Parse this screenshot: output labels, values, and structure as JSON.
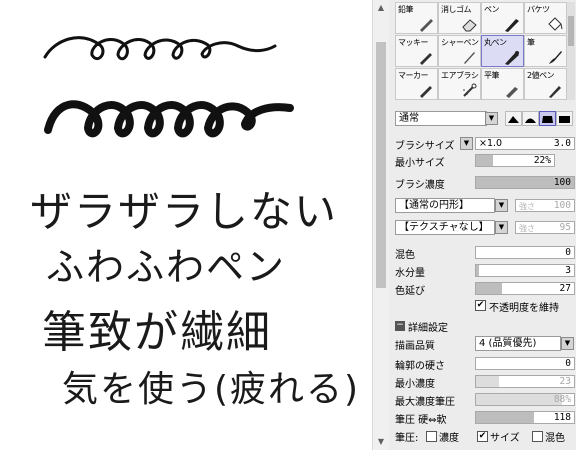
{
  "canvas": {
    "lines": [
      "ザラザラしない",
      "ふわふわペン",
      "筆致が繊細",
      "気を使う(疲れる)"
    ]
  },
  "tools": [
    {
      "label": "鉛筆",
      "icon": "pencil-icon",
      "selected": false
    },
    {
      "label": "消しゴム",
      "icon": "eraser-icon",
      "selected": false
    },
    {
      "label": "ペン",
      "icon": "pen-icon",
      "selected": false
    },
    {
      "label": "バケツ",
      "icon": "bucket-icon",
      "selected": false
    },
    {
      "label": "マッキー",
      "icon": "marker-icon",
      "selected": false
    },
    {
      "label": "シャーペン",
      "icon": "mechanical-pencil-icon",
      "selected": false
    },
    {
      "label": "丸ペン",
      "icon": "round-pen-icon",
      "selected": true
    },
    {
      "label": "筆",
      "icon": "brush-icon",
      "selected": false
    },
    {
      "label": "マーカー",
      "icon": "marker-icon",
      "selected": false
    },
    {
      "label": "エアブラシ",
      "icon": "airbrush-icon",
      "selected": false
    },
    {
      "label": "平筆",
      "icon": "flat-brush-icon",
      "selected": false
    },
    {
      "label": "2値ペン",
      "icon": "binary-pen-icon",
      "selected": false
    }
  ],
  "blend_mode": "通常",
  "brush_size": {
    "label": "ブラシサイズ",
    "multiplier": "×1.0",
    "value": "3.0"
  },
  "min_size": {
    "label": "最小サイズ",
    "value": "22%",
    "fraction": 0.22
  },
  "brush_density": {
    "label": "ブラシ濃度",
    "value": "100",
    "fraction": 1.0
  },
  "shape_select": {
    "value": "【通常の円形】",
    "strength_label": "強さ",
    "strength": "100"
  },
  "texture_select": {
    "value": "【テクスチャなし】",
    "strength_label": "強さ",
    "strength": "95"
  },
  "mix": {
    "label": "混色",
    "value": "0",
    "fraction": 0.0
  },
  "water": {
    "label": "水分量",
    "value": "3",
    "fraction": 0.03
  },
  "stretch": {
    "label": "色延び",
    "value": "27",
    "fraction": 0.27
  },
  "keep_opacity": {
    "label": "不透明度を維持",
    "checked": true
  },
  "advanced": {
    "label": "詳細設定"
  },
  "quality": {
    "label": "描画品質",
    "value": "4 (品質優先)"
  },
  "edge_hardness": {
    "label": "輪郭の硬さ",
    "value": "0",
    "fraction": 0.0
  },
  "min_density": {
    "label": "最小濃度",
    "value": "23",
    "fraction": 0.23
  },
  "max_density_pressure": {
    "label": "最大濃度筆圧",
    "value": "88%",
    "fraction": 0.88
  },
  "pressure_hardness": {
    "label": "筆圧 硬⇔軟",
    "value": "118",
    "fraction": 0.59
  },
  "pressure_row": {
    "label": "筆圧:",
    "density": "濃度",
    "size": "サイズ",
    "mix": "混色",
    "density_checked": false,
    "size_checked": true,
    "mix_checked": false
  }
}
